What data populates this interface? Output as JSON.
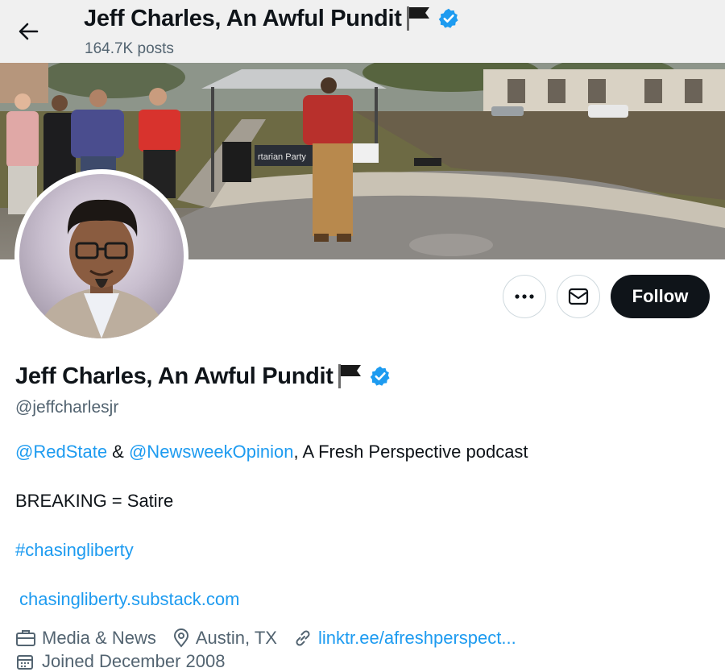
{
  "header": {
    "title": "Jeff Charles, An Awful Pundit",
    "posts": "164.7K posts",
    "back_icon": "arrow-left-icon"
  },
  "banner": {
    "sign_text": "rtarian Party",
    "colors": {
      "grass": "#6b6b3f",
      "pavement": "#8d8a86",
      "tent": "#c9cbcc"
    }
  },
  "actions": {
    "more_icon": "more-icon",
    "message_icon": "envelope-icon",
    "follow_label": "Follow"
  },
  "profile": {
    "name": "Jeff Charles, An Awful Pundit",
    "handle": "@jeffcharlesjr",
    "bio": {
      "mention1": "@RedState",
      "amp": " & ",
      "mention2": "@NewsweekOpinion",
      "rest": ", A Fresh Perspective podcast",
      "line2": "BREAKING = Satire",
      "hashtag": "#chasingliberty",
      "link": "chasingliberty.substack.com"
    },
    "meta": {
      "category": "Media & News",
      "location": "Austin, TX",
      "website": "linktr.ee/afreshperspect...",
      "joined": "Joined December 2008"
    }
  },
  "colors": {
    "accent": "#1d9bf0",
    "text": "#0f1419",
    "muted": "#536471",
    "follow_bg": "#0f1419"
  }
}
